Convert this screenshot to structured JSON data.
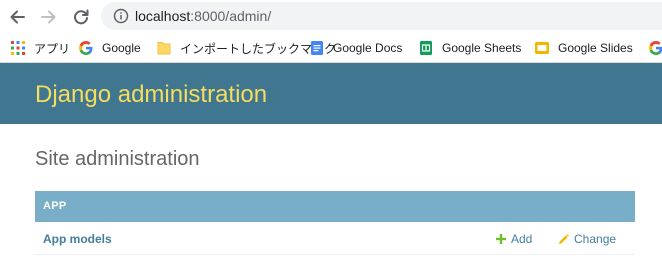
{
  "browser": {
    "url_host": "localhost",
    "url_rest": ":8000/admin/"
  },
  "bookmarks": [
    {
      "label": "アプリ",
      "icon": "apps-grid-icon"
    },
    {
      "label": "Google",
      "icon": "google-icon"
    },
    {
      "label": "インポートしたブックマーク",
      "icon": "folder-icon"
    },
    {
      "label": "Google Docs",
      "icon": "google-docs-icon"
    },
    {
      "label": "Google Sheets",
      "icon": "google-sheets-icon"
    },
    {
      "label": "Google Slides",
      "icon": "google-slides-icon"
    }
  ],
  "header": {
    "brand": "Django administration"
  },
  "main": {
    "title": "Site administration",
    "module": {
      "caption": "APP",
      "rows": [
        {
          "name": "App models",
          "add_label": "Add",
          "change_label": "Change"
        }
      ]
    }
  },
  "colors": {
    "header_bg": "#417690",
    "brand": "#f5dd5d",
    "caption_bg": "#79aec8",
    "link": "#447e9b",
    "add_icon": "#70bf2b",
    "change_icon": "#efb80b"
  }
}
